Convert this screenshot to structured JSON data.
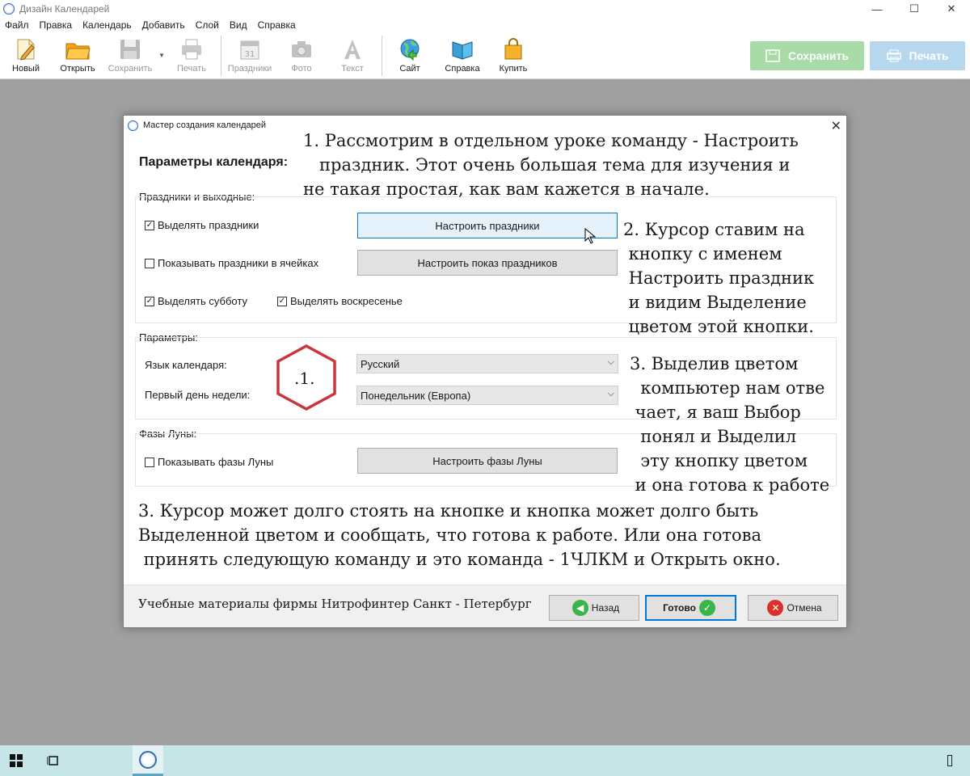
{
  "app": {
    "title": "Дизайн Календарей",
    "window_controls": {
      "minimize": "—",
      "maximize": "☐",
      "close": "✕"
    }
  },
  "menu": [
    "Файл",
    "Правка",
    "Календарь",
    "Добавить",
    "Слой",
    "Вид",
    "Справка"
  ],
  "toolbar": {
    "buttons": [
      {
        "label": "Новый",
        "icon": "new-document-icon",
        "enabled": true
      },
      {
        "label": "Открыть",
        "icon": "open-folder-icon",
        "enabled": true
      },
      {
        "label": "Сохранить",
        "icon": "save-floppy-icon",
        "enabled": false
      },
      {
        "label": "Печать",
        "icon": "printer-icon",
        "enabled": false
      },
      {
        "label": "Праздники",
        "icon": "calendar-icon",
        "enabled": false
      },
      {
        "label": "Фото",
        "icon": "camera-icon",
        "enabled": false
      },
      {
        "label": "Текст",
        "icon": "text-icon",
        "enabled": false
      },
      {
        "label": "Сайт",
        "icon": "globe-icon",
        "enabled": true
      },
      {
        "label": "Справка",
        "icon": "book-icon",
        "enabled": true
      },
      {
        "label": "Купить",
        "icon": "shopping-bag-icon",
        "enabled": true
      }
    ],
    "save_big": "Сохранить",
    "print_big": "Печать",
    "colors": {
      "save_big": "#a9dba8",
      "print_big": "#b7d7ef"
    }
  },
  "dialog": {
    "title": "Мастер создания календарей",
    "close": "✕",
    "heading": "Параметры календаря:",
    "holidays": {
      "label": "Праздники и выходные:",
      "chk_highlight": "Выделять праздники",
      "chk_show_in_cells": "Показывать праздники в ячейках",
      "chk_saturday": "Выделять субботу",
      "chk_sunday": "Выделять воскресенье",
      "btn_configure": "Настроить праздники",
      "btn_configure_display": "Настроить показ праздников"
    },
    "params": {
      "label": "Параметры:",
      "language_label": "Язык календаря:",
      "language_value": "Русский",
      "first_day_label": "Первый день недели:",
      "first_day_value": "Понедельник (Европа)"
    },
    "moon": {
      "label": "Фазы Луны:",
      "chk_show": "Показывать фазы Луны",
      "btn_configure": "Настроить фазы Луны"
    },
    "footer": {
      "text": "Учебные материалы фирмы Нитрофинтер Санкт - Петербург",
      "back": "Назад",
      "done": "Готово",
      "cancel": "Отмена"
    }
  },
  "annotations": {
    "note1": "1. Рассмотрим в отдельном уроке команду - Настроить\n   праздник. Этот очень большая тема для изучения и\nне такая простая, как вам кажется в начале.",
    "note2": "2. Курсор ставим на\n кнопку с именем\n Настроить праздник\n и видим Выделение\n цветом этой кнопки.",
    "note3": "3. Выделив цветом\n  компьютер нам отве\n чает, я ваш Выбор\n  понял и Выделил\n  эту кнопку цветом\n и она готова к работе",
    "note4": "3. Курсор может долго стоять на кнопке и кнопка может долго быть\nВыделенной цветом и сообщать, что готова к работе. Или она готова\n принять следующую команду и это команда - 1ЧЛКМ и Открыть окно.",
    "hex_label": ".1.",
    "hex_color": "#c9363b"
  }
}
